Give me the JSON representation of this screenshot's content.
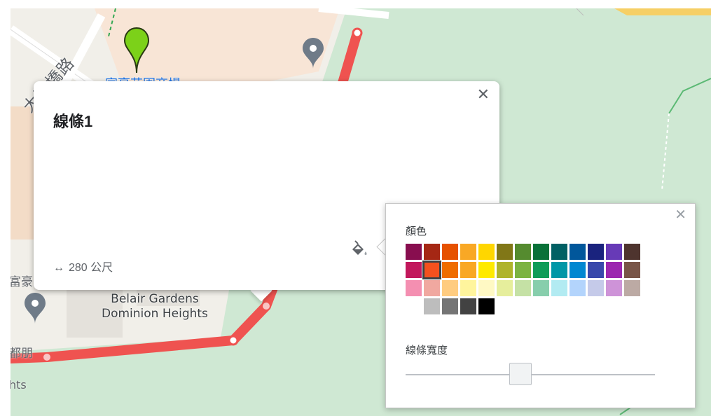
{
  "map": {
    "road_label": "大涌橋路",
    "partial_place_label": "富豪花園商場",
    "place_label_line1": "Belair Gardens",
    "place_label_line2": "Dominion Heights",
    "left_edge_label": "富豪",
    "left_edge_label2": "都朋",
    "left_edge_label3": "hts",
    "route_color": "#ef5350"
  },
  "info_popup": {
    "title": "線條1",
    "measurement": "280 公尺",
    "measurement_icon": "horizontal-double-arrow-icon",
    "close_icon": "close-icon",
    "style_icon": "paint-bucket-icon"
  },
  "color_panel": {
    "color_label": "顏色",
    "width_label": "線條寬度",
    "close_icon": "close-icon",
    "selected_color": "#f4511e",
    "line_width_fraction": 0.46,
    "palette_rows": [
      [
        "#880e4f",
        "#a52714",
        "#e65100",
        "#f9a825",
        "#ffd600",
        "#817717",
        "#558b2f",
        "#097138",
        "#006064",
        "#01579b",
        "#1a237e",
        "#673ab7",
        "#4e342e"
      ],
      [
        "#c2185b",
        "#f4511e",
        "#ef6c00",
        "#f9a825",
        "#ffea00",
        "#afb42b",
        "#7cb342",
        "#0f9d58",
        "#0097a7",
        "#0288d1",
        "#3949ab",
        "#9c27b0",
        "#795548"
      ],
      [
        "#f48fb1",
        "#f0a8a0",
        "#ffcc80",
        "#fff59d",
        "#fff9c4",
        "#e6ee9c",
        "#c5e1a5",
        "#87ceac",
        "#b2ebf2",
        "#b3d4fc",
        "#c5cae9",
        "#ce93d8",
        "#bcaaa4"
      ],
      [
        "",
        "#bdbdbd",
        "#757575",
        "#424242",
        "#000000",
        "",
        "",
        "",
        "",
        "",
        "",
        "",
        ""
      ]
    ]
  }
}
